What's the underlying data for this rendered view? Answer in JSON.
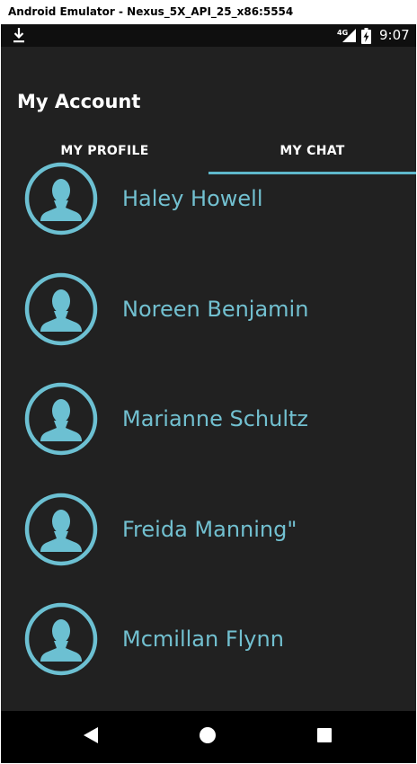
{
  "window": {
    "title": "Android Emulator - Nexus_5X_API_25_x86:5554"
  },
  "status_bar": {
    "left_icon": "download-icon",
    "network": "4G",
    "time": "9:07"
  },
  "app_bar": {
    "title": "My Account",
    "tabs": [
      {
        "label": "MY PROFILE",
        "selected": false
      },
      {
        "label": "MY CHAT",
        "selected": true
      }
    ]
  },
  "contacts": [
    {
      "name": "Haley Howell",
      "icon": "person-avatar-icon"
    },
    {
      "name": "Noreen Benjamin",
      "icon": "person-avatar-icon"
    },
    {
      "name": "Marianne Schultz",
      "icon": "person-avatar-icon"
    },
    {
      "name": "Freida Manning\"",
      "icon": "person-avatar-icon"
    },
    {
      "name": "Mcmillan Flynn",
      "icon": "person-avatar-icon"
    }
  ],
  "nav_bar": {
    "buttons": [
      "back-icon",
      "home-icon",
      "recents-icon"
    ]
  },
  "colors": {
    "accent": "#5fb8cc",
    "contact_text": "#72c0d0",
    "background": "#212121",
    "status_bar": "#0f0f0f",
    "nav_bar": "#000000"
  }
}
